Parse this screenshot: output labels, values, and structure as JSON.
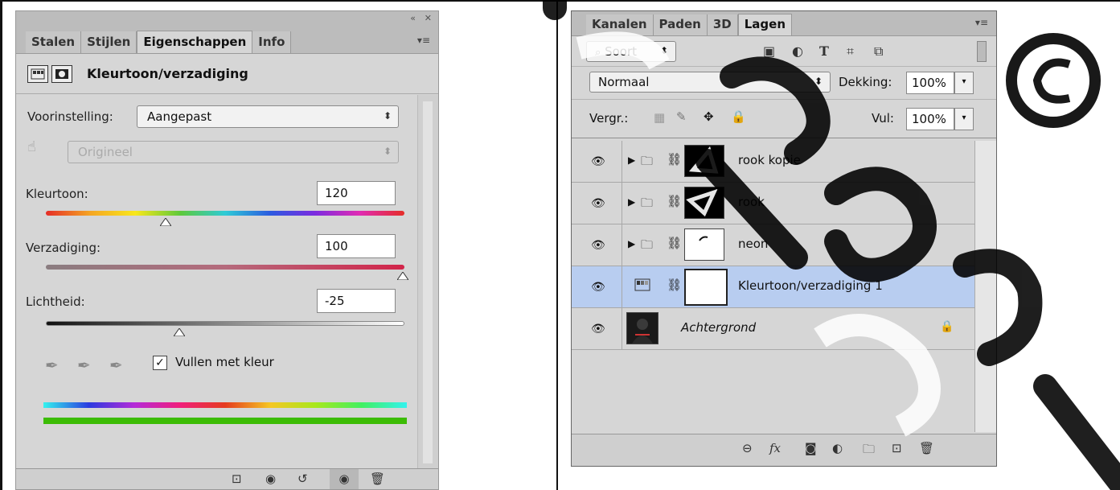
{
  "left_panel": {
    "tabs": [
      "Stalen",
      "Stijlen",
      "Eigenschappen",
      "Info"
    ],
    "active_tab": "Eigenschappen",
    "title": "Kleurtoon/verzadiging",
    "preset_label": "Voorinstelling:",
    "preset_value": "Aangepast",
    "channel_value": "Origineel",
    "hue_label": "Kleurtoon:",
    "hue_value": "120",
    "saturation_label": "Verzadiging:",
    "saturation_value": "100",
    "lightness_label": "Lichtheid:",
    "lightness_value": "-25",
    "colorize_label": "Vullen met kleur",
    "colorize_checked": true
  },
  "right_panel": {
    "tabs": [
      "Kanalen",
      "Paden",
      "3D",
      "Lagen"
    ],
    "active_tab": "Lagen",
    "filter_value": "Soort",
    "blend_mode": "Normaal",
    "opacity_label": "Dekking:",
    "opacity_value": "100%",
    "lock_label": "Vergr.:",
    "fill_label": "Vul:",
    "fill_value": "100%",
    "layers": [
      {
        "name": "rook kopie",
        "type": "group",
        "selected": false
      },
      {
        "name": "rook",
        "type": "group",
        "selected": false
      },
      {
        "name": "neon",
        "type": "group",
        "selected": false
      },
      {
        "name": "Kleurtoon/verzadiging 1",
        "type": "adjustment",
        "selected": true
      },
      {
        "name": "Achtergrond",
        "type": "background",
        "selected": false,
        "locked": true
      }
    ]
  },
  "colors": {
    "panel_bg": "#d6d6d6",
    "selected_layer": "#b8cdf0",
    "watermark": "#000000"
  }
}
